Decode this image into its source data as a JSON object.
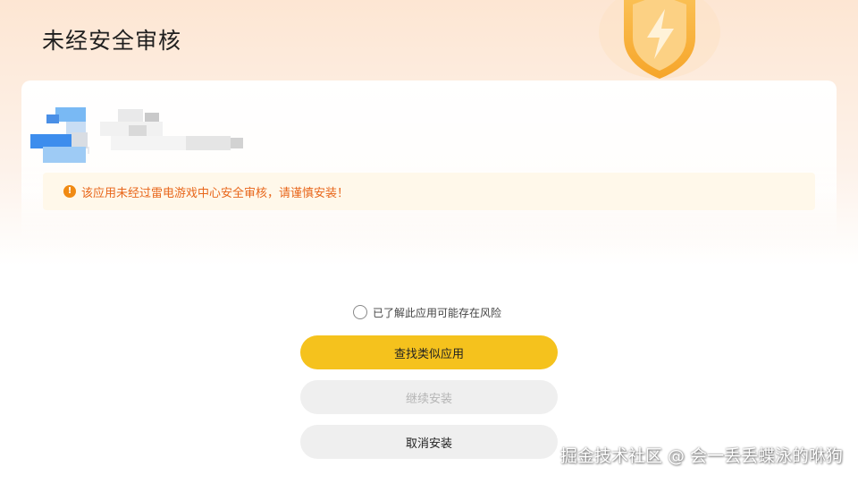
{
  "header": {
    "title": "未经安全审核",
    "badge_icon": "shield-lightning-icon"
  },
  "app": {
    "icon": "app-icon",
    "name_state": "blurred"
  },
  "warning": {
    "icon": "alert-circle-icon",
    "icon_glyph": "!",
    "text": "该应用未经过雷电游戏中心安全审核，请谨慎安装！",
    "color": "#e8661a"
  },
  "consent": {
    "label": "已了解此应用可能存在风险",
    "checked": false
  },
  "buttons": {
    "find_similar": "查找类似应用",
    "continue_install": "继续安装",
    "cancel_install": "取消安装"
  },
  "colors": {
    "accent": "#f5c21d",
    "warning_bg": "#fff8ea",
    "disabled_text": "#b5b5b5"
  },
  "watermark": "掘金技术社区 @ 会一丢丢蝶泳的咻狗"
}
